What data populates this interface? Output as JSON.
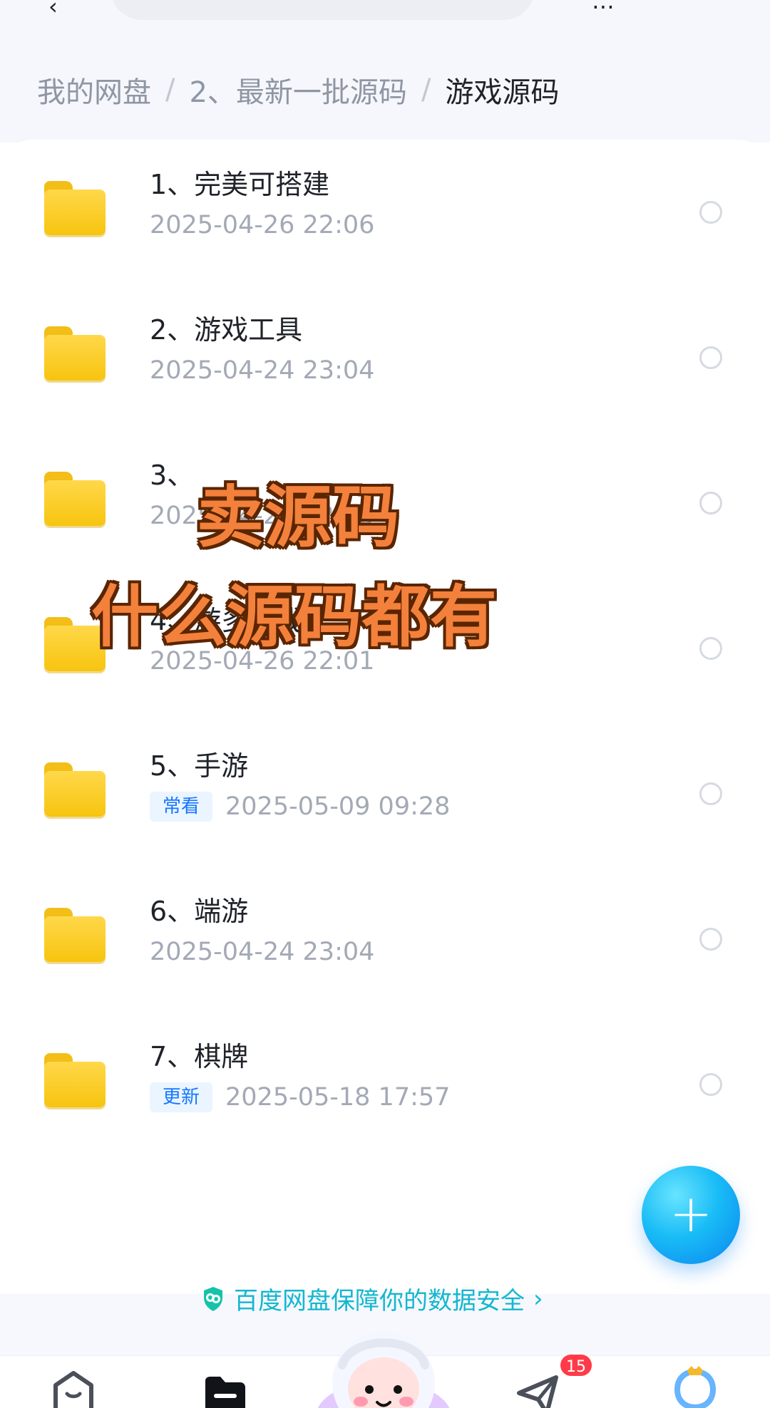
{
  "header": {
    "breadcrumb": [
      "我的网盘",
      "2、最新一批源码",
      "游戏源码"
    ],
    "separator": "/"
  },
  "items": [
    {
      "title": "1、完美可搭建",
      "date": "2025-04-26  22:06",
      "badge": ""
    },
    {
      "title": "2、游戏工具",
      "date": "2025-04-24  23:04",
      "badge": ""
    },
    {
      "title": "3、",
      "date": "2025-04-26  22:13",
      "badge": ""
    },
    {
      "title": "4、游多游戏",
      "date": "2025-04-26  22:01",
      "badge": ""
    },
    {
      "title": "5、手游",
      "date": "2025-05-09  09:28",
      "badge": "常看"
    },
    {
      "title": "6、端游",
      "date": "2025-04-24  23:04",
      "badge": ""
    },
    {
      "title": "7、棋牌",
      "date": "2025-05-18  17:57",
      "badge": "更新"
    }
  ],
  "overlay": {
    "line1": "卖源码",
    "line2": "什么源码都有"
  },
  "fab": {
    "label": "+"
  },
  "security": {
    "text": "百度网盘保障你的数据安全"
  },
  "nav": {
    "share_badge": "15"
  },
  "colors": {
    "accent": "#1677ff",
    "folder": "#f7c40f",
    "overlay": "#f3813b",
    "security": "#13b7cf"
  },
  "icons": {
    "home": "home-icon",
    "files": "folder-tab-icon",
    "share": "send-icon",
    "profile": "profile-icon",
    "shield": "shield-icon"
  }
}
